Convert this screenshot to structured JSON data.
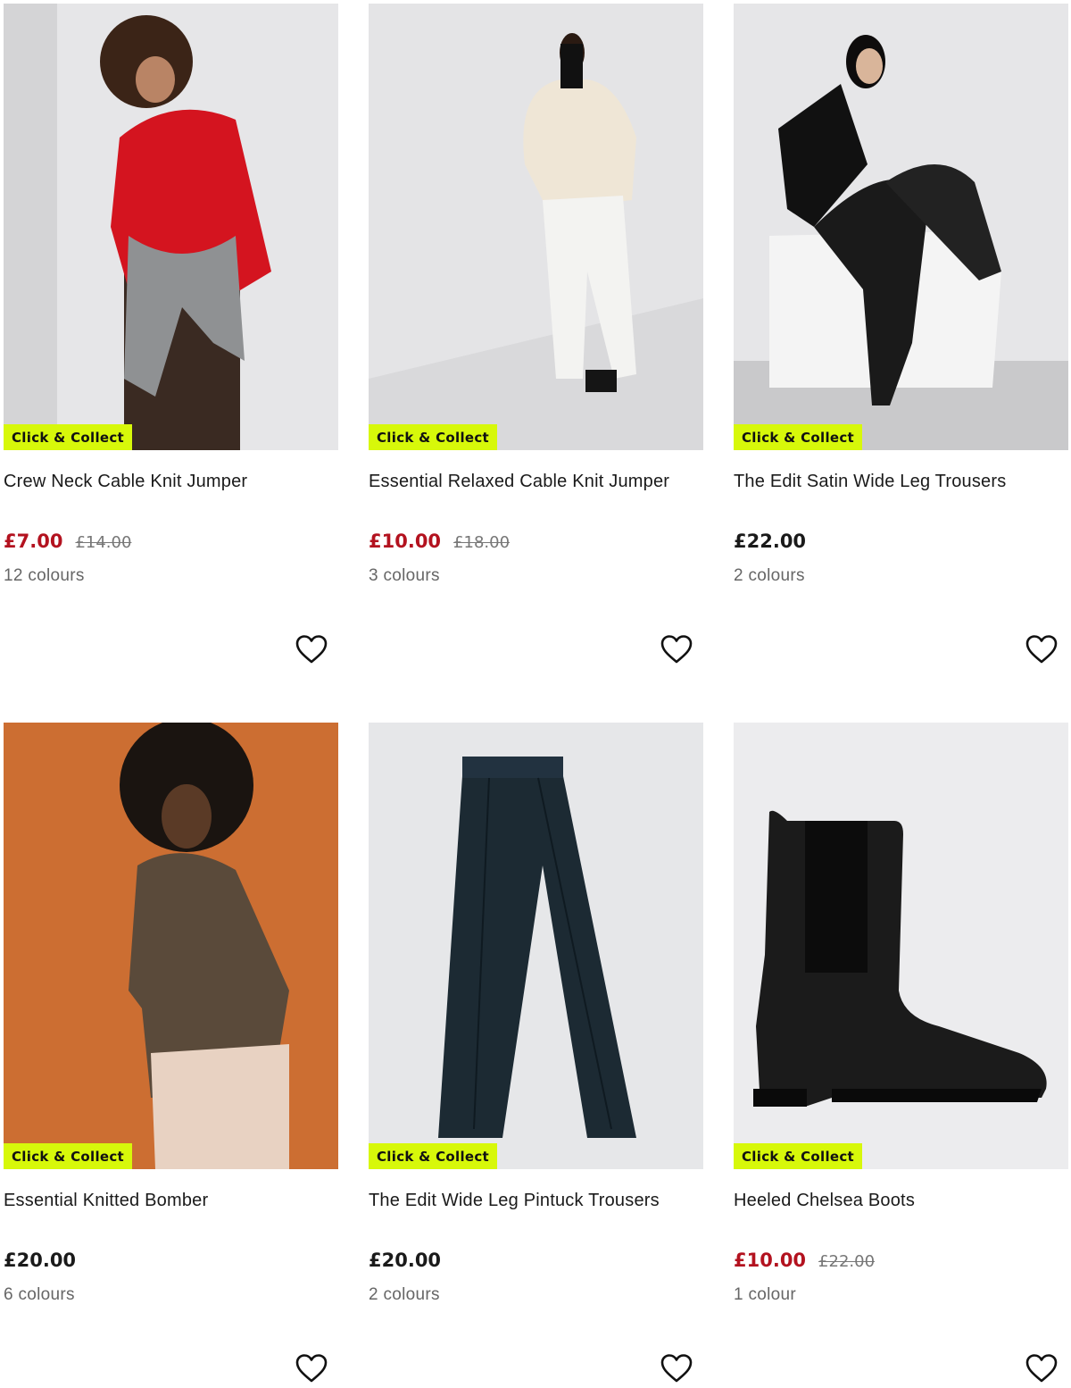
{
  "products": [
    {
      "badge": "Click & Collect",
      "title": "Crew Neck Cable Knit Jumper",
      "price": "£7.00",
      "was": "£14.00",
      "colours": "12 colours",
      "on_sale": true
    },
    {
      "badge": "Click & Collect",
      "title": "Essential Relaxed Cable Knit Jumper",
      "price": "£10.00",
      "was": "£18.00",
      "colours": "3 colours",
      "on_sale": true
    },
    {
      "badge": "Click & Collect",
      "title": "The Edit Satin Wide Leg Trousers",
      "price": "£22.00",
      "was": "",
      "colours": "2 colours",
      "on_sale": false
    },
    {
      "badge": "Click & Collect",
      "title": "Essential Knitted Bomber",
      "price": "£20.00",
      "was": "",
      "colours": "6 colours",
      "on_sale": false
    },
    {
      "badge": "Click & Collect",
      "title": "The Edit Wide Leg Pintuck Trousers",
      "price": "£20.00",
      "was": "",
      "colours": "2 colours",
      "on_sale": false
    },
    {
      "badge": "Click & Collect",
      "title": "Heeled Chelsea Boots",
      "price": "£10.00",
      "was": "£22.00",
      "colours": "1 colour",
      "on_sale": true
    }
  ],
  "colors": {
    "badge": "#d7f80a",
    "sale_price": "#b3121f"
  },
  "icons": {
    "wishlist": "heart-outline-icon"
  }
}
